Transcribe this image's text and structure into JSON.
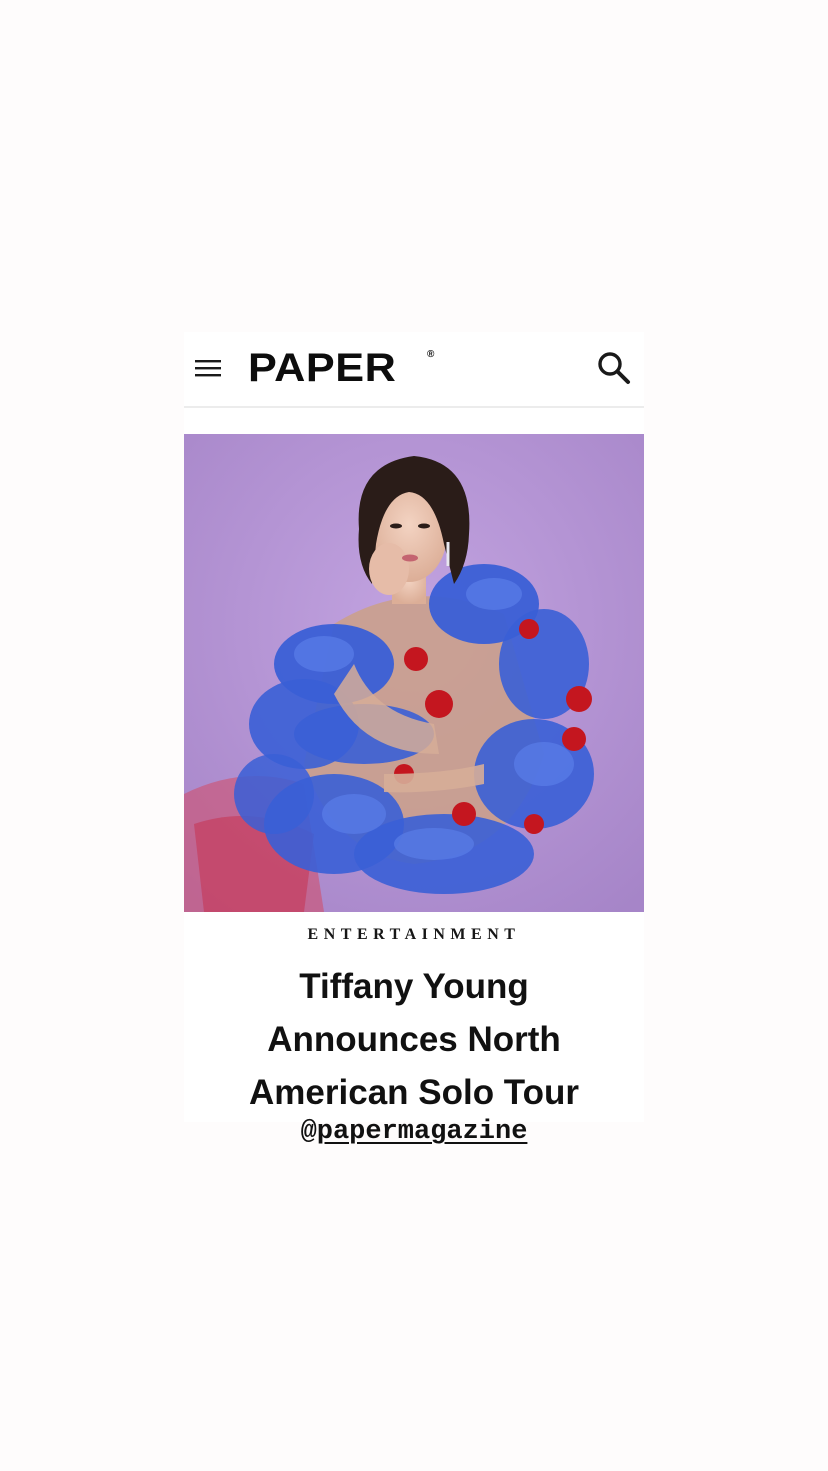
{
  "header": {
    "logo": "PAPER",
    "logo_mark": "®",
    "menu_icon": "hamburger-menu-icon",
    "search_icon": "search-icon"
  },
  "article": {
    "category": "ENTERTAINMENT",
    "headline_lines": [
      "Tiffany Young",
      "Announces North",
      "American Solo Tour"
    ]
  },
  "story": {
    "mention_at": "@",
    "mention_handle": "papermagazine"
  },
  "colors": {
    "background": "#fefcfc",
    "photo_backdrop": "#b08fd0",
    "ruffle_blue": "#3a5fd6",
    "tulle_red": "#d23a4a",
    "text": "#111111"
  }
}
